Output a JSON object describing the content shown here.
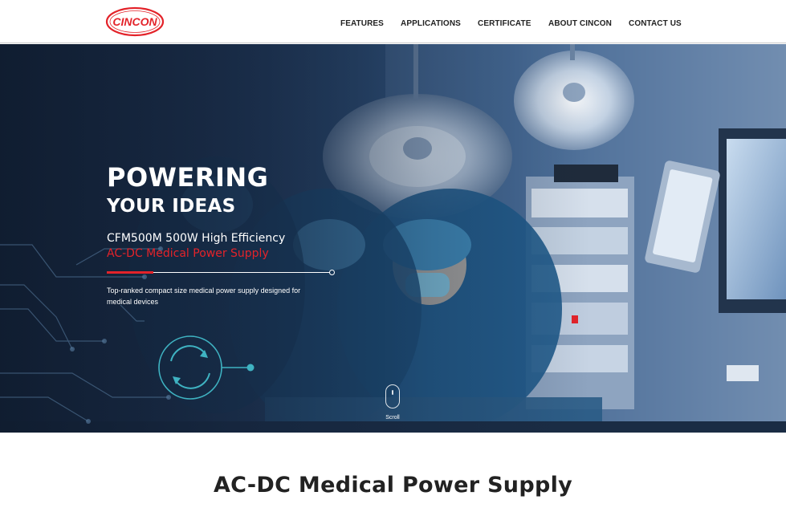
{
  "brand": {
    "logo_text": "CINCON",
    "accent_color": "#e3232a"
  },
  "nav": {
    "items": [
      {
        "label": "FEATURES"
      },
      {
        "label": "APPLICATIONS"
      },
      {
        "label": "CERTIFICATE"
      },
      {
        "label": "ABOUT CINCON"
      },
      {
        "label": "CONTACT US"
      }
    ]
  },
  "hero": {
    "title_line1": "POWERING",
    "title_line2": "YOUR IDEAS",
    "product_line": "CFM500M 500W High Efficiency",
    "product_subline": "AC-DC Medical Power Supply",
    "description": "Top-ranked compact size medical power supply designed for medical devices",
    "scroll_label": "Scroll",
    "background_image": "surgical-team-operating-room-photo"
  },
  "section": {
    "title": "AC-DC Medical Power Supply"
  }
}
